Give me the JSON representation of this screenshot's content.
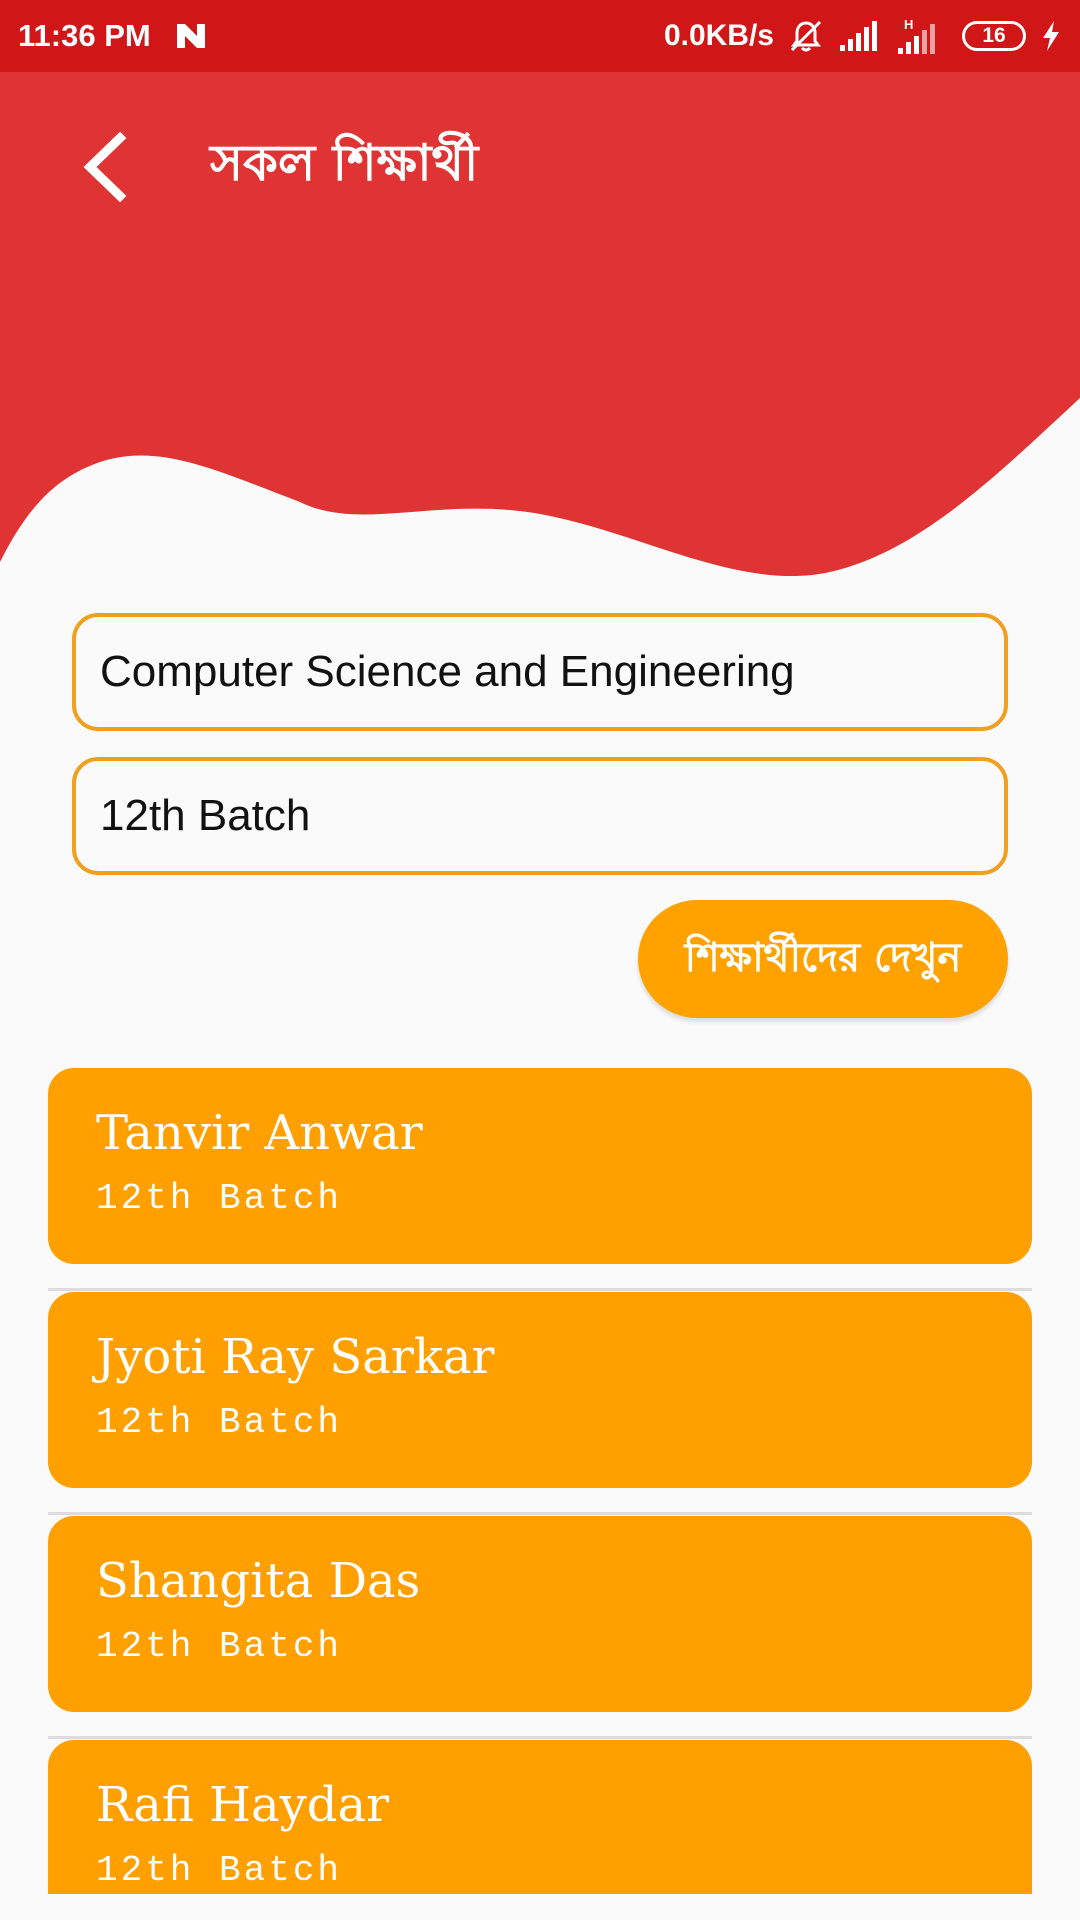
{
  "status_bar": {
    "time": "11:36 PM",
    "network_speed": "0.0KB/s",
    "network_type": "H",
    "battery_level": "16",
    "icons": [
      "n-notification-icon",
      "bell-muted-icon",
      "signal-icon",
      "signal-h-icon",
      "battery-icon",
      "charging-icon"
    ]
  },
  "header": {
    "back_icon": "chevron-left-icon",
    "title": "সকল শিক্ষার্থী",
    "colors": {
      "primary": "#e03434",
      "status": "#d01617"
    }
  },
  "filters": {
    "department_value": "Computer Science and Engineering",
    "batch_value": "12th Batch",
    "border_color": "#f0a020"
  },
  "view_button": {
    "label": "শিক্ষার্থীদের দেখুন",
    "color": "#ffa200"
  },
  "students": [
    {
      "name": "Tanvir Anwar",
      "batch": "12th Batch"
    },
    {
      "name": "Jyoti Ray Sarkar",
      "batch": "12th Batch"
    },
    {
      "name": "Shangita Das",
      "batch": "12th Batch"
    },
    {
      "name": "Rafi Haydar",
      "batch": "12th Batch"
    }
  ],
  "card_color": "#ffa000"
}
